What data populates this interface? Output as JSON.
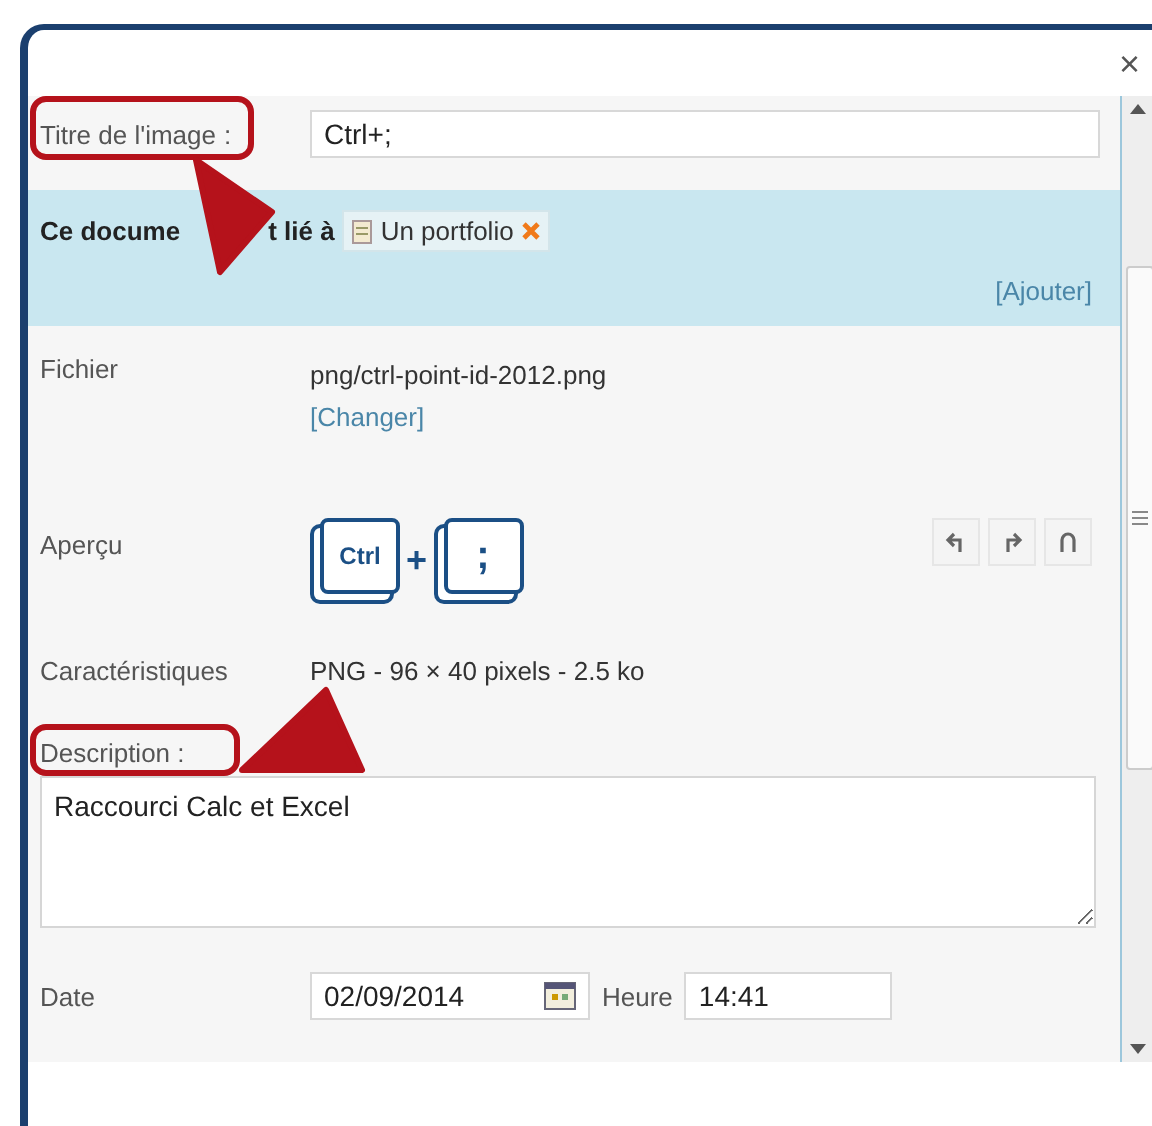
{
  "dialog": {
    "close": "×"
  },
  "title_field": {
    "label": "Titre de l'image",
    "colon": ":",
    "value": "Ctrl+;"
  },
  "linked": {
    "label_start": "Ce docume",
    "label_end": "t lié à",
    "tag": "Un portfolio",
    "add": "[Ajouter]"
  },
  "file": {
    "label": "Fichier",
    "path": "png/ctrl-point-id-2012.png",
    "change": "[Changer]"
  },
  "preview": {
    "label": "Aperçu",
    "keys": [
      "Ctrl",
      ";"
    ],
    "plus": "+"
  },
  "specs": {
    "label": "Caractéristiques",
    "value": "PNG - 96 × 40 pixels - 2.5 ko"
  },
  "description": {
    "label": "Description :",
    "value": "Raccourci Calc et Excel"
  },
  "date": {
    "label": "Date",
    "value": "02/09/2014",
    "time_label": "Heure",
    "time": "14:41"
  }
}
